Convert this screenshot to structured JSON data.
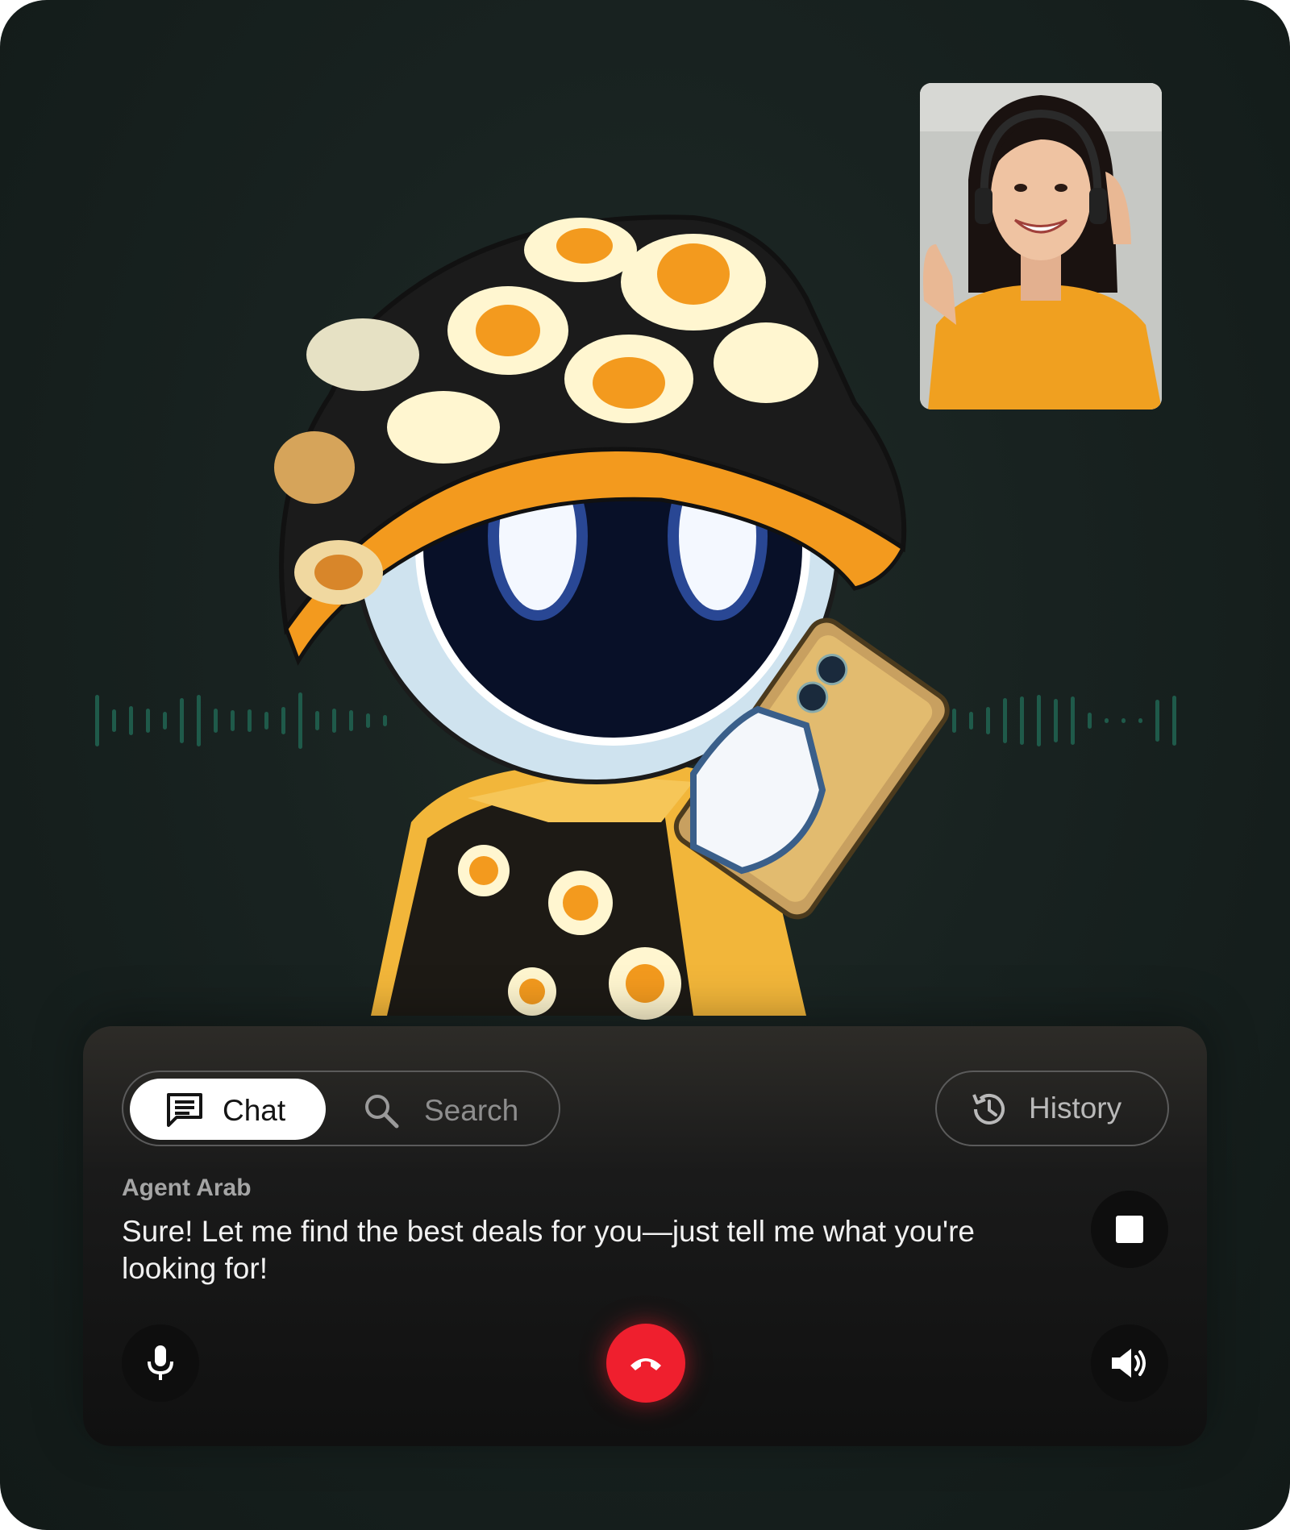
{
  "tabs": [
    {
      "label": "Chat",
      "icon": "chat-icon",
      "active": true
    },
    {
      "label": "Search",
      "icon": "search-icon",
      "active": false
    }
  ],
  "history": {
    "label": "History",
    "icon": "history-icon"
  },
  "agent": {
    "name": "Agent Arab",
    "message": "Sure! Let me find the best deals for you—just tell me what you're looking for!"
  },
  "controls": {
    "stop": "stop-icon",
    "mic": "microphone-icon",
    "end_call": "phone-hangup-icon",
    "speaker": "speaker-icon"
  },
  "colors": {
    "end_call": "#ef1f2e",
    "wave": "#1f5a4a",
    "hat_yolk": "#f39a1e",
    "suit": "#f2b63a"
  }
}
